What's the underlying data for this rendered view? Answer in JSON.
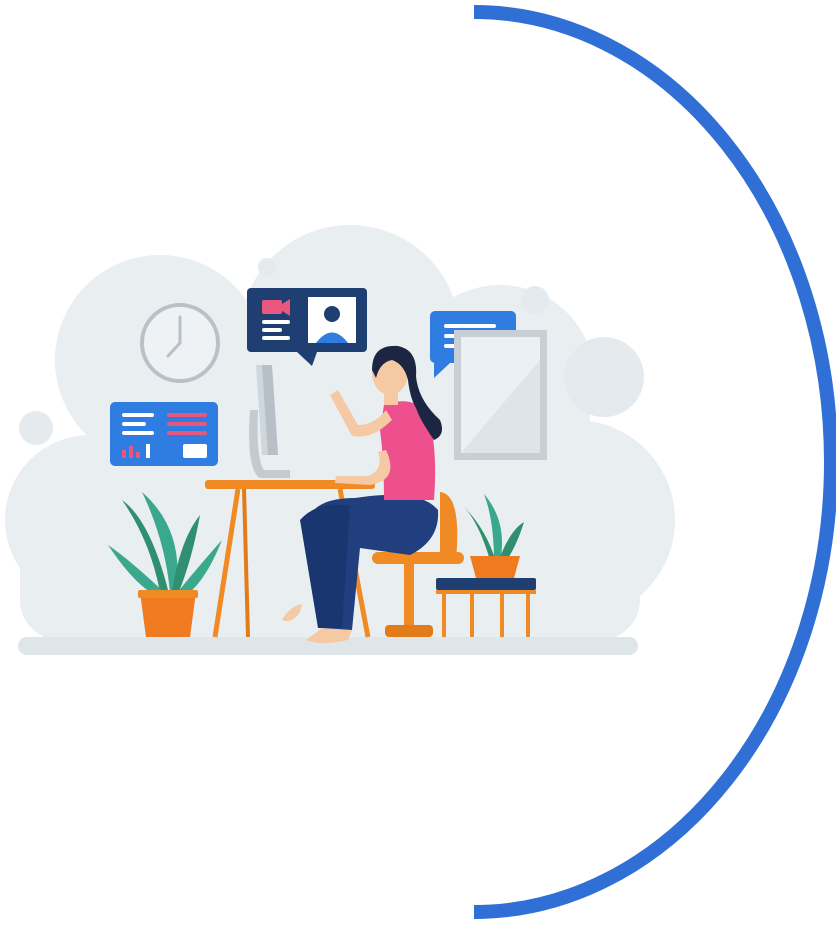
{
  "colors": {
    "background": "#ffffff",
    "arc": "#2f6fd6",
    "cloud": "#e9eef1",
    "cloud_dot": "#e4eaee",
    "floor": "#dfe6ea",
    "card_blue": "#2f7de1",
    "card_navy": "#1f3f73",
    "accent_pink": "#e9577f",
    "shirt_pink": "#ee4f8d",
    "jeans": "#213f7e",
    "hair": "#1c2541",
    "skin": "#f6c9a5",
    "desk_orange": "#f08a24",
    "pot_orange": "#ef7a1f",
    "leaf_green": "#2f8f6f",
    "leaf_teal": "#3aa88c",
    "monitor_gray": "#cfd6dc",
    "clock_gray": "#b9c1c8",
    "frame_gray": "#bfc7cd"
  },
  "icons": [
    "wall-clock-icon",
    "dashboard-card-icon",
    "video-call-bubble-icon",
    "chat-bubble-icon",
    "wall-frame-icon",
    "computer-monitor-icon",
    "desk-icon",
    "chair-icon",
    "potted-plant-icon",
    "side-stool-icon"
  ]
}
